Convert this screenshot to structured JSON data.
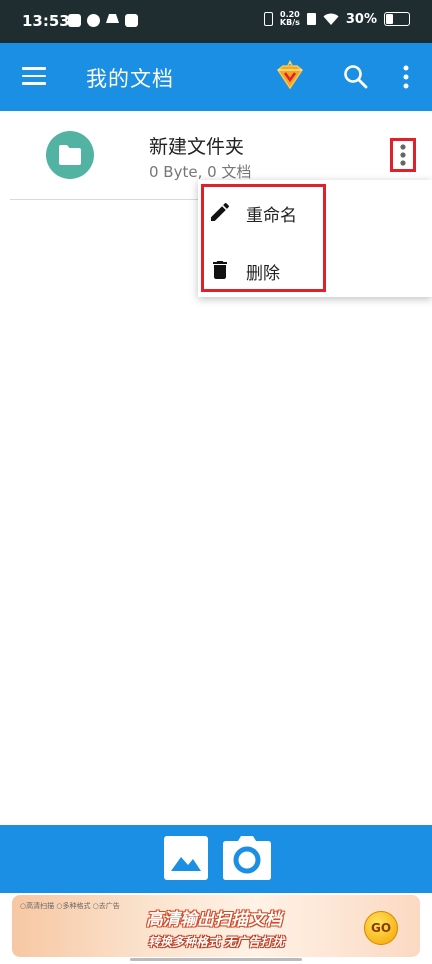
{
  "status_bar": {
    "time": "13:53",
    "net_speed_value": "0.20",
    "net_speed_unit": "KB/s",
    "battery_text": "30%",
    "battery_level": 0.3
  },
  "app_bar": {
    "title": "我的文档",
    "icons": [
      "menu-icon",
      "vip-diamond-icon",
      "search-icon",
      "more-vertical-icon"
    ]
  },
  "files": [
    {
      "name": "新建文件夹",
      "meta": "0 Byte, 0 文档",
      "icon": "folder-icon"
    }
  ],
  "popup_menu": {
    "items": [
      {
        "label": "重命名",
        "icon": "pencil-icon"
      },
      {
        "label": "删除",
        "icon": "trash-icon"
      }
    ]
  },
  "bottom_bar": {
    "icons": [
      "image-gallery-icon",
      "camera-icon"
    ]
  },
  "ad": {
    "tags": "○高清扫描 ○多种格式 ○去广告",
    "title": "高清输出扫描文档",
    "subtitle": "转换多种格式 无广告打扰",
    "go_label": "GO"
  },
  "colors": {
    "status_bar": "#1f2d31",
    "primary": "#1a8fe3",
    "folder_avatar": "#52b3a3",
    "highlight_red": "#e0202a"
  }
}
